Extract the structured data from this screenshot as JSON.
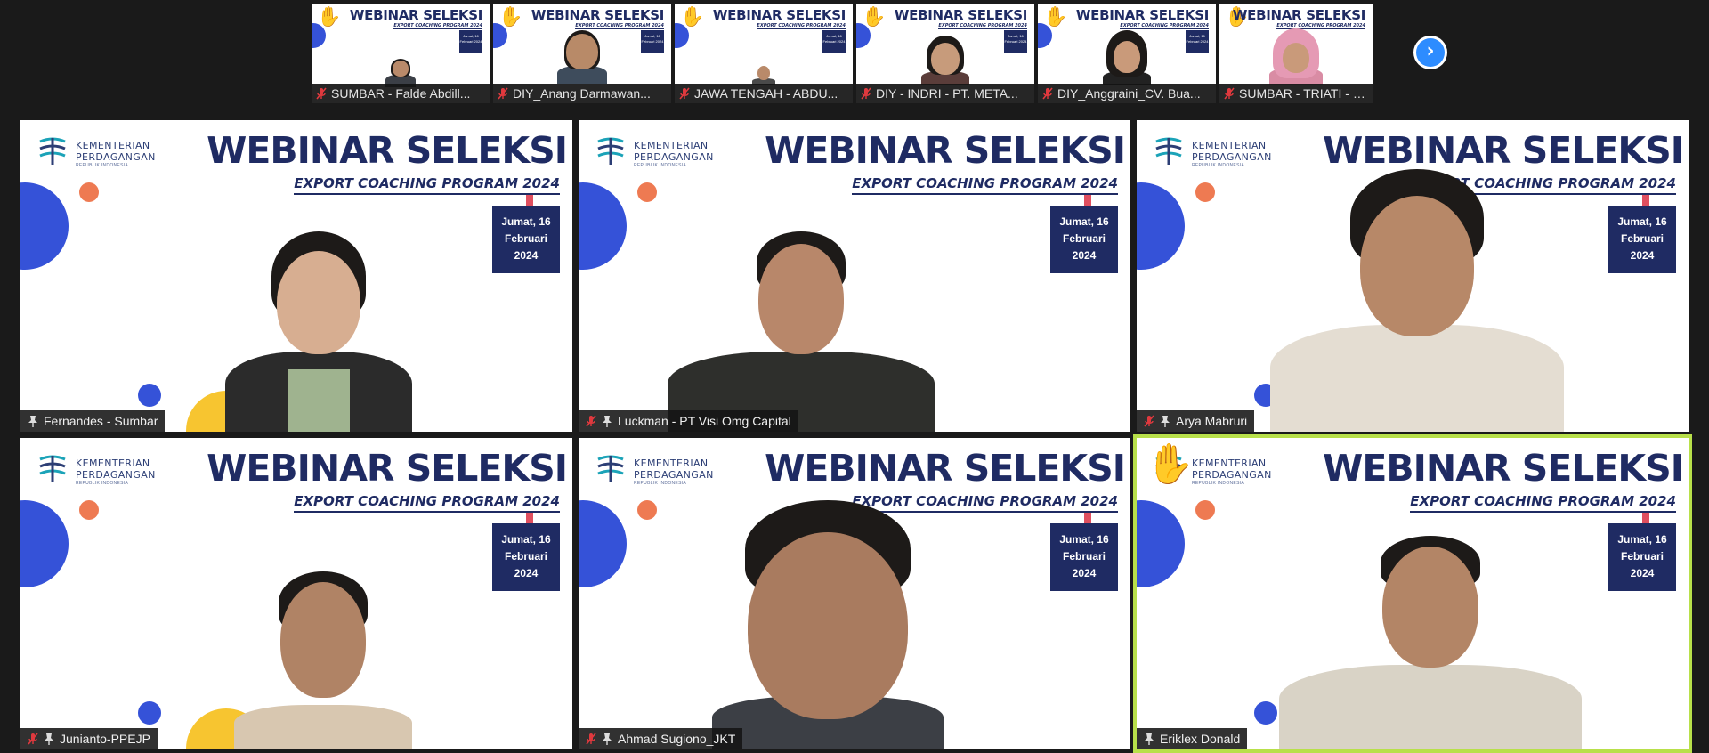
{
  "filmstrip": {
    "thumbnails": [
      {
        "name": "SUMBAR - Falde Abdill...",
        "title": "WEBINAR SELEKSI",
        "subtitle": "EXPORT COACHING PROGRAM 2024",
        "date": "Jumat, 16 Februari 2024"
      },
      {
        "name": "DIY_Anang Darmawan...",
        "title": "WEBINAR SELEKSI",
        "subtitle": "EXPORT COACHING PROGRAM 2024",
        "date": "Jumat, 16 Februari 2024"
      },
      {
        "name": "JAWA TENGAH - ABDU...",
        "title": "WEBINAR SELEKSI",
        "subtitle": "EXPORT COACHING PROGRAM 2024",
        "date": "Jumat, 16 Februari 2024"
      },
      {
        "name": "DIY - INDRI - PT. META...",
        "title": "WEBINAR SELEKSI",
        "subtitle": "EXPORT COACHING PROGRAM 2024",
        "date": "Jumat, 16 Februari 2024"
      },
      {
        "name": "DIY_Anggraini_CV. Bua...",
        "title": "WEBINAR SELEKSI",
        "subtitle": "EXPORT COACHING PROGRAM 2024",
        "date": "Jumat, 16 Februari 2024"
      },
      {
        "name": "SUMBAR - TRIATI - RE...",
        "title": "WEBINAR SELEKSI",
        "subtitle": "EXPORT COACHING PROGRAM 2024",
        "date": "Jumat, 16 Februari 2024"
      }
    ],
    "next_icon": "chevron-right-icon"
  },
  "slide": {
    "org_line1": "KEMENTERIAN",
    "org_line2": "PERDAGANGAN",
    "org_line3": "REPUBLIK INDONESIA",
    "title": "WEBINAR SELEKSI",
    "subtitle": "EXPORT COACHING PROGRAM 2024",
    "date_line1": "Jumat, 16",
    "date_line2": "Februari",
    "date_line3": "2024"
  },
  "participants": [
    {
      "name": "Fernandes - Sumbar",
      "muted": false,
      "pinned": true
    },
    {
      "name": "Luckman - PT Visi Omg Capital",
      "muted": true,
      "pinned": true
    },
    {
      "name": "Arya Mabruri",
      "muted": true,
      "pinned": true
    },
    {
      "name": "Junianto-PPEJP",
      "muted": true,
      "pinned": true
    },
    {
      "name": "Ahmad Sugiono_JKT",
      "muted": true,
      "pinned": true
    },
    {
      "name": "Eriklex Donald",
      "muted": false,
      "pinned": true,
      "active_speaker": true,
      "hand_raised": true
    }
  ],
  "colors": {
    "navy": "#1f2b63",
    "blue": "#3552d8",
    "orange": "#ee7a52",
    "yellow": "#f7c530",
    "active_border": "#b8e04a",
    "mute_red": "#e0393e",
    "next_button": "#2d8cff"
  }
}
